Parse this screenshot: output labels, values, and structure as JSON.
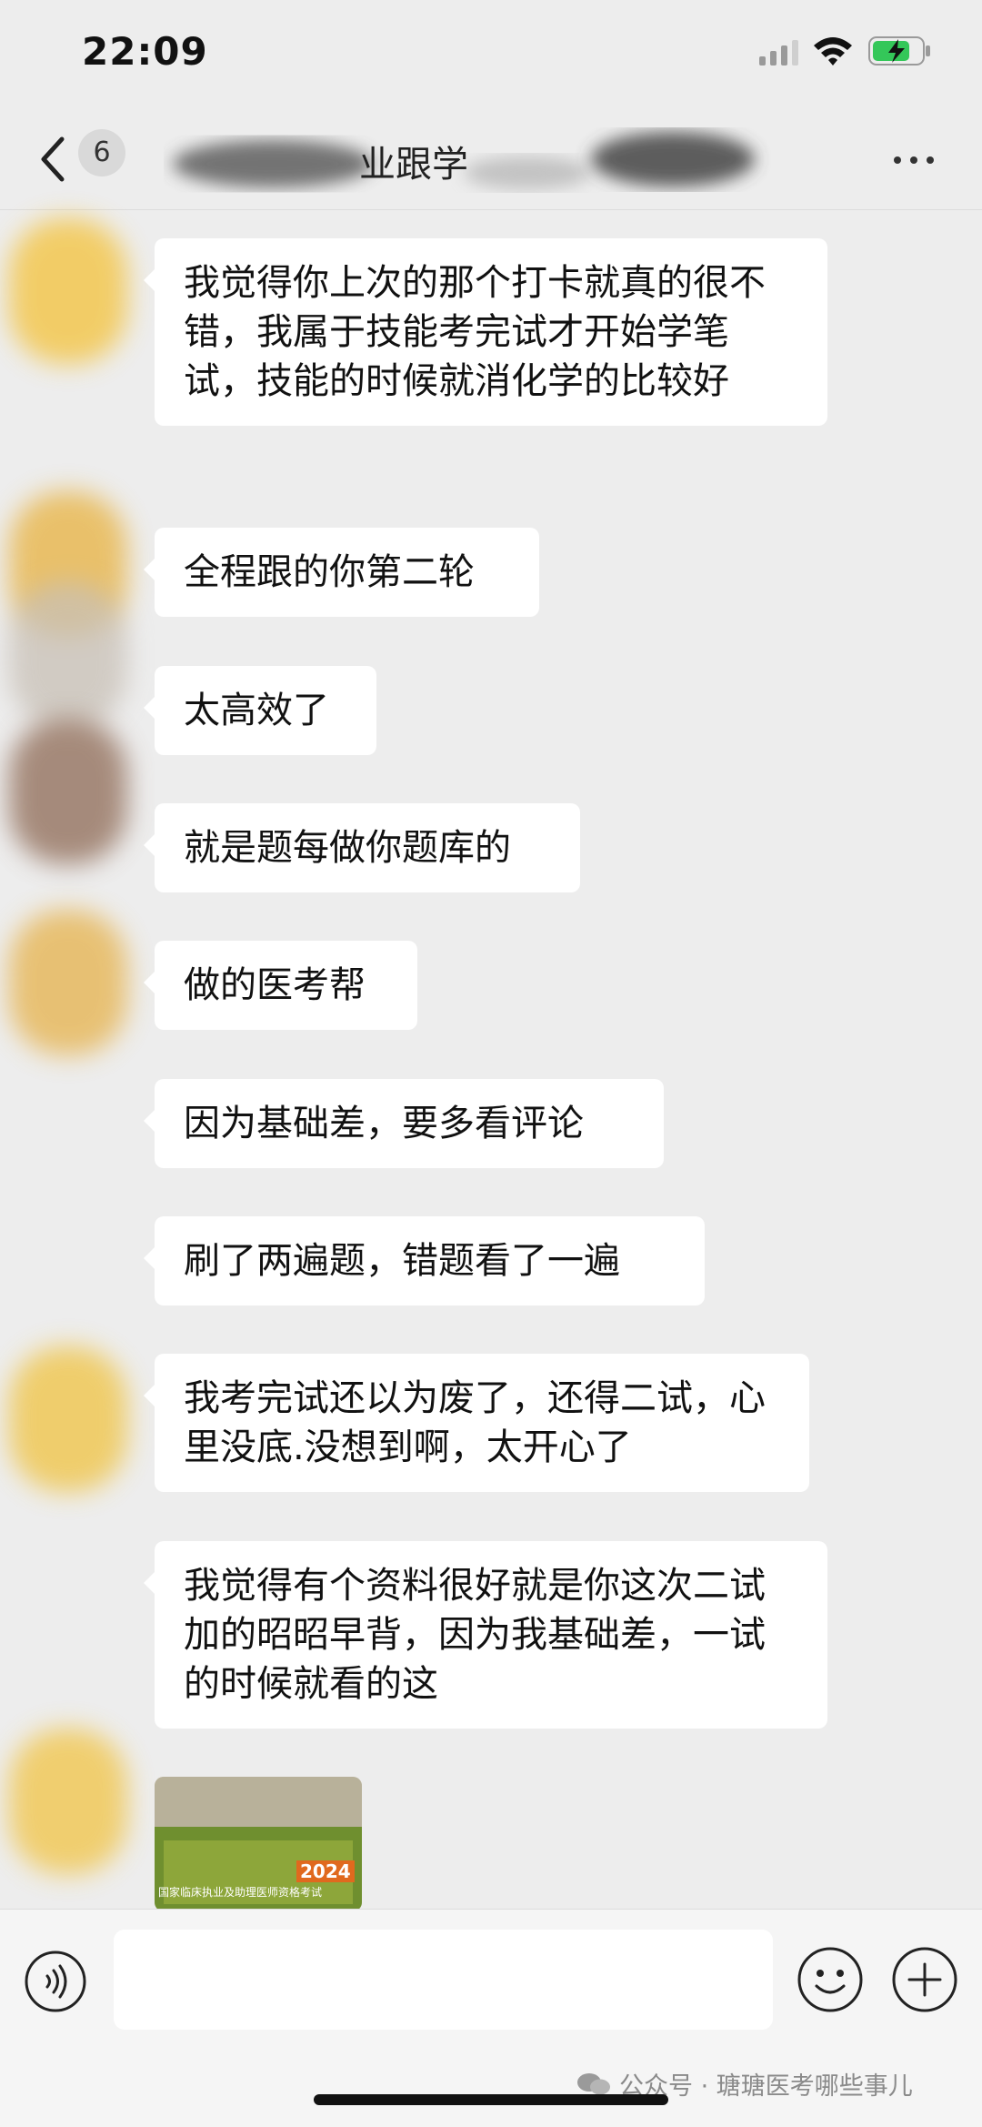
{
  "status_bar": {
    "time": "22:09"
  },
  "header": {
    "back_badge": "6",
    "title": "业跟学"
  },
  "messages": [
    "我觉得你上次的那个打卡就真的很不错，我属于技能考完试才开始学笔试，技能的时候就消化学的比较好",
    "全程跟的你第二轮",
    "太高效了",
    "就是题每做你题库的",
    "做的医考帮",
    "因为基础差，要多看评论",
    "刷了两遍题，错题看了一遍",
    "我考完试还以为废了，还得二试，心里没底.没想到啊，太开心了",
    "我觉得有个资料很好就是你这次二试加的昭昭早背，因为我基础差，一试的时候就看的这"
  ],
  "image_message": {
    "year": "2024",
    "caption": "国家临床执业及助理医师资格考试"
  },
  "input": {
    "placeholder": ""
  },
  "watermark": "公众号 · 瑭瑭医考哪些事儿"
}
